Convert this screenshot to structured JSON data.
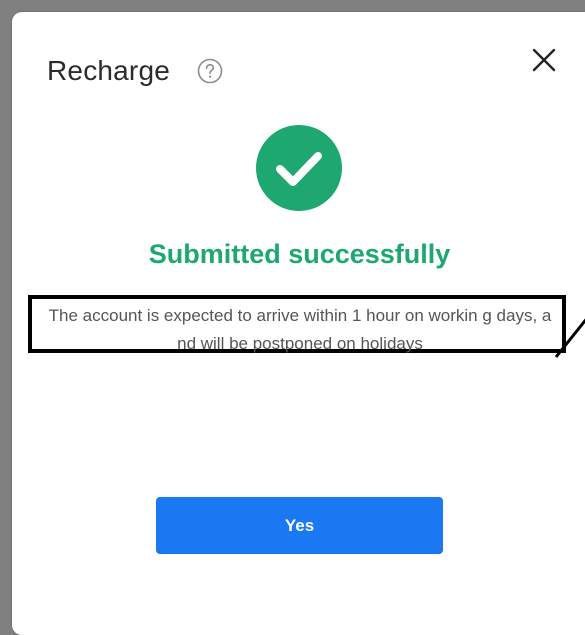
{
  "dialog": {
    "title": "Recharge",
    "help_icon": "question-circle-icon",
    "close_icon": "close-x-icon"
  },
  "status": {
    "icon": "checkmark-circle-icon",
    "headline": "Submitted successfully",
    "note": "The account is expected to arrive within 1 hour on workin g days, and will be postponed on holidays"
  },
  "actions": {
    "confirm_label": "Yes"
  },
  "colors": {
    "success": "#1ea771",
    "primary": "#1a78f2",
    "annotation_border": "#000000"
  }
}
